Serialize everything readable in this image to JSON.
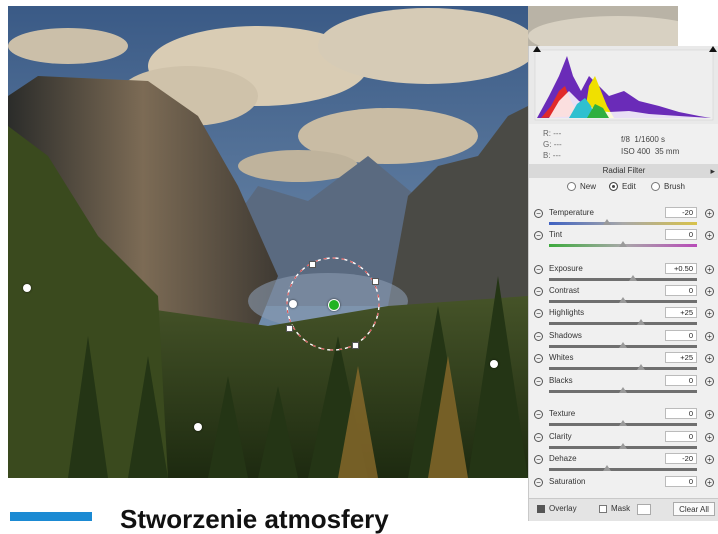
{
  "article": {
    "heading": "Stworzenie atmosfery"
  },
  "panel": {
    "info": {
      "r_label": "R:",
      "g_label": "G:",
      "b_label": "B:",
      "r_value": "---",
      "g_value": "---",
      "b_value": "---",
      "aperture": "f/8",
      "shutter": "1/1600 s",
      "iso": "ISO 400",
      "focal": "35 mm"
    },
    "tool_title": "Radial Filter",
    "modes": {
      "new": "New",
      "edit": "Edit",
      "brush": "Brush",
      "selected": "Edit"
    },
    "sliders": [
      {
        "label": "Temperature",
        "value": "-20"
      },
      {
        "label": "Tint",
        "value": "0"
      },
      {
        "label": "Exposure",
        "value": "+0.50"
      },
      {
        "label": "Contrast",
        "value": "0"
      },
      {
        "label": "Highlights",
        "value": "+25"
      },
      {
        "label": "Shadows",
        "value": "0"
      },
      {
        "label": "Whites",
        "value": "+25"
      },
      {
        "label": "Blacks",
        "value": "0"
      },
      {
        "label": "Texture",
        "value": "0"
      },
      {
        "label": "Clarity",
        "value": "0"
      },
      {
        "label": "Dehaze",
        "value": "-20"
      },
      {
        "label": "Saturation",
        "value": "0"
      }
    ],
    "footer": {
      "overlay": "Overlay",
      "overlay_checked": true,
      "mask": "Mask",
      "mask_checked": false,
      "clear_all": "Clear All"
    }
  },
  "colors": {
    "accent": "#1b8ad3",
    "filter_pin": "#22b322"
  },
  "icons": {
    "clip_shadow": "triangle-icon",
    "clip_highlight": "triangle-icon",
    "minus": "minus-circle-icon",
    "plus": "plus-circle-icon"
  }
}
